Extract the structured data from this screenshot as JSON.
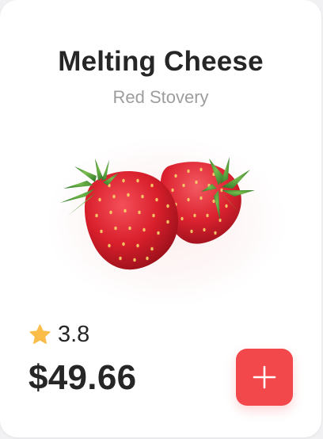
{
  "product": {
    "name": "Melting Cheese",
    "subtitle": "Red Stovery",
    "image_icon": "strawberries-image",
    "rating": "3.8",
    "price": "$49.66"
  },
  "actions": {
    "add_icon": "plus-icon"
  },
  "colors": {
    "accent": "#f2484b",
    "star": "#fbbd4a",
    "text_primary": "#262626",
    "text_secondary": "#9d9d9f",
    "card_background": "#ffffff"
  }
}
